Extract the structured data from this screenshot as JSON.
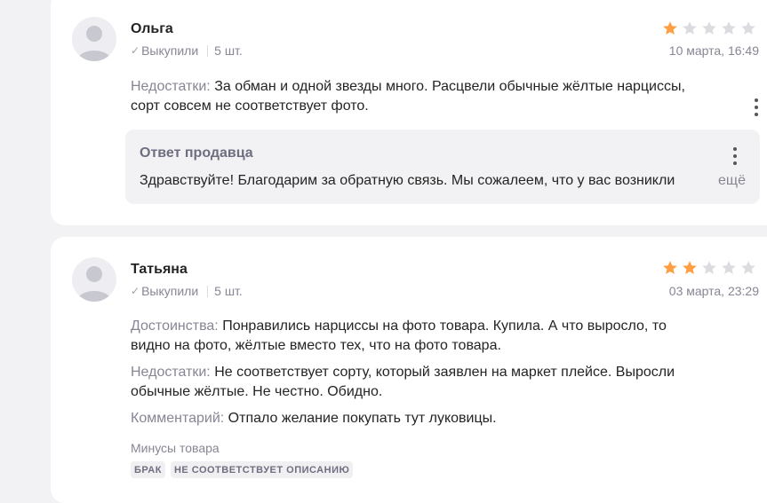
{
  "reviews": [
    {
      "author": "Ольга",
      "verified_label": "Выкупили",
      "quantity": "5 шт.",
      "rating": 1,
      "max_rating": 5,
      "date": "10 марта, 16:49",
      "fields": [
        {
          "label": "Недостатки:",
          "text_1": "За обман и одной звезды много. Расцвели обычные жёлтые нарциссы,",
          "text_2": "сорт совсем не соответствует фото."
        }
      ],
      "seller_reply": {
        "title": "Ответ продавца",
        "text": "Здравствуйте! Благодарим за обратную связь. Мы сожалеем, что у вас возникли",
        "more_label": "ещё"
      }
    },
    {
      "author": "Татьяна",
      "verified_label": "Выкупили",
      "quantity": "5 шт.",
      "rating": 2,
      "max_rating": 5,
      "date": "03 марта, 23:29",
      "fields": [
        {
          "label": "Достоинства:",
          "text_1": "Понравились нарциссы на фото товара. Купила. А что выросло, то",
          "text_2": "видно на фото, жёлтые вместо тех, что на фото товара."
        },
        {
          "label": "Недостатки:",
          "text_1": "Не соответствует сорту, который заявлен на маркет плейсе. Выросли",
          "text_2": "обычные жёлтые. Не честно. Обидно."
        },
        {
          "label": "Комментарий:",
          "text_1": "Отпало желание покупать тут луковицы."
        }
      ],
      "cons_title": "Минусы товара",
      "cons_tags": [
        "БРАК",
        "НЕ СООТВЕТСТВУЕТ ОПИСАНИЮ"
      ]
    }
  ],
  "colors": {
    "star_filled": "#ff9f43",
    "star_empty": "#dcdce0",
    "page_background": "#f2f2f5"
  },
  "icons": [
    "avatar-placeholder-icon",
    "checkmark-icon",
    "star-icon",
    "more-vertical-icon"
  ]
}
